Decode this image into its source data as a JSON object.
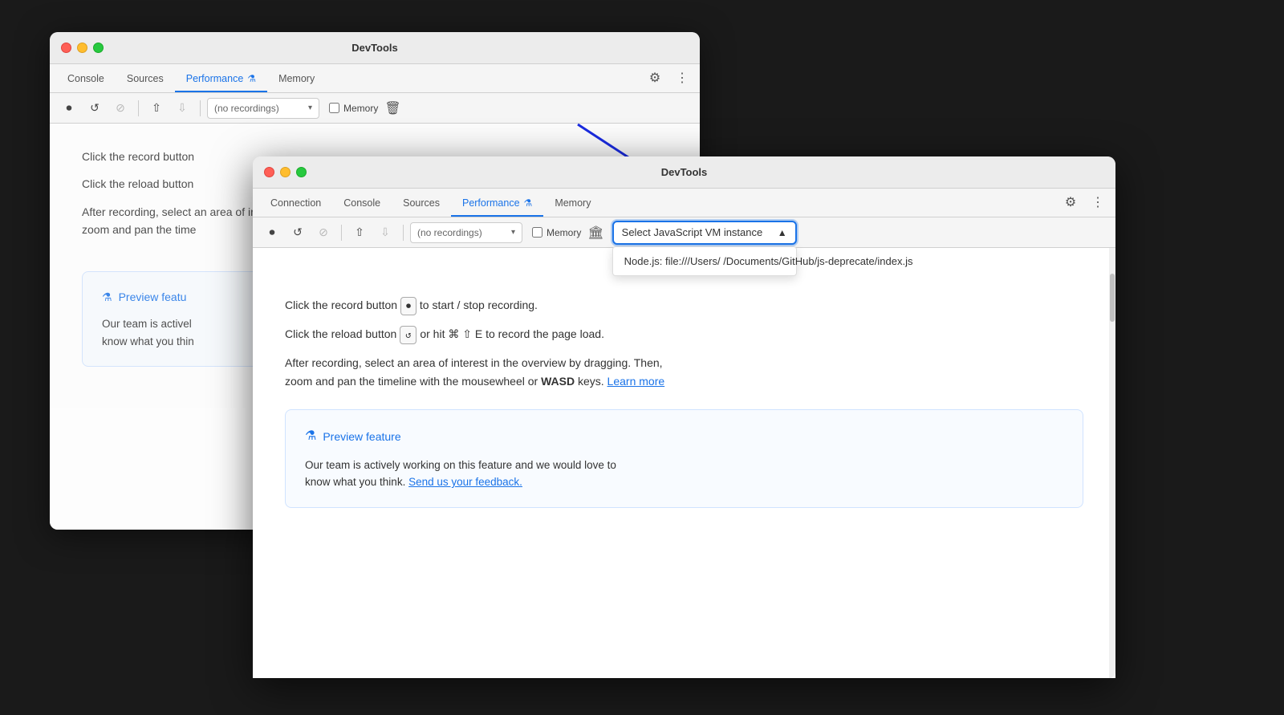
{
  "back_window": {
    "title": "DevTools",
    "tabs": [
      {
        "label": "Console",
        "active": false
      },
      {
        "label": "Sources",
        "active": false
      },
      {
        "label": "Performance",
        "active": true
      },
      {
        "label": "Memory",
        "active": false
      }
    ],
    "toolbar": {
      "recordings_placeholder": "no recordings",
      "memory_label": "Memory"
    },
    "content": {
      "line1": "Click the record button",
      "line2": "Click the reload button",
      "line3_part1": "After recording, select an area of interest in the overview by dragging. Then,",
      "line3_part2": "zoom and pan the time",
      "preview_title": "Preview featu",
      "preview_text": "Our team is activel",
      "preview_text2": "know what you thin"
    }
  },
  "front_window": {
    "title": "DevTools",
    "tabs": [
      {
        "label": "Connection",
        "active": false
      },
      {
        "label": "Console",
        "active": false
      },
      {
        "label": "Sources",
        "active": false
      },
      {
        "label": "Performance",
        "active": true
      },
      {
        "label": "Memory",
        "active": false
      }
    ],
    "toolbar": {
      "recordings_placeholder": "no recordings",
      "memory_label": "Memory"
    },
    "vm_selector": {
      "label": "Select JavaScript VM instance",
      "dropdown_item": "Node.js: file:///Users/      /Documents/GitHub/js-deprecate/index.js"
    },
    "content": {
      "record_line": "Click the record button",
      "reload_line": "Click the reload button",
      "reload_shortcut": "or hit ⌘ ⇧ E to record the page load.",
      "after_line1": "After recording, select an area of interest in the overview by dragging. Then,",
      "after_line2": "zoom and pan the timeline with the mousewheel or",
      "after_bold": "WASD",
      "after_keys": "keys.",
      "learn_more": "Learn more",
      "preview_title": "Preview feature",
      "preview_text1": "Our team is actively working on this feature and we would love to",
      "preview_text2": "know what you think.",
      "feedback_link": "Send us your feedback."
    }
  },
  "icons": {
    "close": "●",
    "minimize": "●",
    "maximize": "●",
    "settings": "⚙",
    "more": "⋮",
    "record": "⏺",
    "reload": "↺",
    "cancel": "⊘",
    "upload": "↑",
    "download": "↓",
    "trash": "🗑",
    "storage": "🏛",
    "flask": "⚗",
    "arrow_down": "▾"
  }
}
